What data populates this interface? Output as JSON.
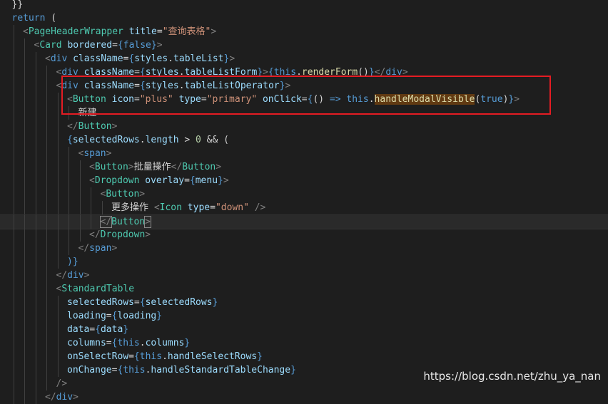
{
  "colors": {
    "background": "#1e1e1e",
    "tag_bracket": "#808080",
    "tag": "#4ec9b0",
    "attr": "#9cdcfe",
    "string": "#ce9178",
    "keyword": "#569cd6",
    "plain": "#d4d4d4",
    "function": "#dcdcaa",
    "number": "#b5cea8",
    "highlight_box": "#e51c23"
  },
  "lines": [
    {
      "indent": 1,
      "tokens": [
        {
          "t": "}}",
          "c": "plain"
        }
      ]
    },
    {
      "indent": 1,
      "tokens": [
        {
          "t": "return",
          "c": "keyword"
        },
        {
          "t": " (",
          "c": "plain"
        }
      ]
    },
    {
      "indent": 2,
      "tokens": [
        {
          "t": "<",
          "c": "tag_bracket"
        },
        {
          "t": "PageHeaderWrapper",
          "c": "tag"
        },
        {
          "t": " ",
          "c": "plain"
        },
        {
          "t": "title",
          "c": "attr"
        },
        {
          "t": "=",
          "c": "plain"
        },
        {
          "t": "\"查询表格\"",
          "c": "string"
        },
        {
          "t": ">",
          "c": "tag_bracket"
        }
      ]
    },
    {
      "indent": 3,
      "tokens": [
        {
          "t": "<",
          "c": "tag_bracket"
        },
        {
          "t": "Card",
          "c": "tag"
        },
        {
          "t": " ",
          "c": "plain"
        },
        {
          "t": "bordered",
          "c": "attr"
        },
        {
          "t": "=",
          "c": "plain"
        },
        {
          "t": "{",
          "c": "keyword"
        },
        {
          "t": "false",
          "c": "keyword"
        },
        {
          "t": "}",
          "c": "keyword"
        },
        {
          "t": ">",
          "c": "tag_bracket"
        }
      ]
    },
    {
      "indent": 4,
      "tokens": [
        {
          "t": "<",
          "c": "tag_bracket"
        },
        {
          "t": "div",
          "c": "keyword"
        },
        {
          "t": " ",
          "c": "plain"
        },
        {
          "t": "className",
          "c": "attr"
        },
        {
          "t": "=",
          "c": "plain"
        },
        {
          "t": "{",
          "c": "keyword"
        },
        {
          "t": "styles",
          "c": "attr"
        },
        {
          "t": ".",
          "c": "plain"
        },
        {
          "t": "tableList",
          "c": "attr"
        },
        {
          "t": "}",
          "c": "keyword"
        },
        {
          "t": ">",
          "c": "tag_bracket"
        }
      ]
    },
    {
      "indent": 5,
      "tokens": [
        {
          "t": "<",
          "c": "tag_bracket"
        },
        {
          "t": "div",
          "c": "keyword"
        },
        {
          "t": " ",
          "c": "plain"
        },
        {
          "t": "className",
          "c": "attr"
        },
        {
          "t": "=",
          "c": "plain"
        },
        {
          "t": "{",
          "c": "keyword"
        },
        {
          "t": "styles",
          "c": "attr"
        },
        {
          "t": ".",
          "c": "plain"
        },
        {
          "t": "tableListForm",
          "c": "attr"
        },
        {
          "t": "}",
          "c": "keyword"
        },
        {
          "t": ">",
          "c": "tag_bracket"
        },
        {
          "t": "{",
          "c": "keyword"
        },
        {
          "t": "this",
          "c": "keyword"
        },
        {
          "t": ".",
          "c": "plain"
        },
        {
          "t": "renderForm",
          "c": "function"
        },
        {
          "t": "()",
          "c": "plain"
        },
        {
          "t": "}",
          "c": "keyword"
        },
        {
          "t": "</",
          "c": "tag_bracket"
        },
        {
          "t": "div",
          "c": "keyword"
        },
        {
          "t": ">",
          "c": "tag_bracket"
        }
      ]
    },
    {
      "indent": 5,
      "tokens": [
        {
          "t": "<",
          "c": "tag_bracket"
        },
        {
          "t": "div",
          "c": "keyword"
        },
        {
          "t": " ",
          "c": "plain"
        },
        {
          "t": "className",
          "c": "attr"
        },
        {
          "t": "=",
          "c": "plain"
        },
        {
          "t": "{",
          "c": "keyword"
        },
        {
          "t": "styles",
          "c": "attr"
        },
        {
          "t": ".",
          "c": "plain"
        },
        {
          "t": "tableListOperator",
          "c": "attr"
        },
        {
          "t": "}",
          "c": "keyword"
        },
        {
          "t": ">",
          "c": "tag_bracket"
        }
      ]
    },
    {
      "indent": 6,
      "tokens": [
        {
          "t": "<",
          "c": "tag_bracket"
        },
        {
          "t": "Button",
          "c": "tag"
        },
        {
          "t": " ",
          "c": "plain"
        },
        {
          "t": "icon",
          "c": "attr"
        },
        {
          "t": "=",
          "c": "plain"
        },
        {
          "t": "\"plus\"",
          "c": "string"
        },
        {
          "t": " ",
          "c": "plain"
        },
        {
          "t": "type",
          "c": "attr"
        },
        {
          "t": "=",
          "c": "plain"
        },
        {
          "t": "\"primary\"",
          "c": "string"
        },
        {
          "t": " ",
          "c": "plain"
        },
        {
          "t": "onClick",
          "c": "attr"
        },
        {
          "t": "=",
          "c": "plain"
        },
        {
          "t": "{",
          "c": "keyword"
        },
        {
          "t": "()",
          "c": "plain"
        },
        {
          "t": " => ",
          "c": "keyword"
        },
        {
          "t": "this",
          "c": "keyword"
        },
        {
          "t": ".",
          "c": "plain"
        },
        {
          "t": "handleModalVisible",
          "c": "function",
          "hl": true
        },
        {
          "t": "(",
          "c": "plain"
        },
        {
          "t": "true",
          "c": "keyword"
        },
        {
          "t": ")",
          "c": "plain"
        },
        {
          "t": "}",
          "c": "keyword"
        },
        {
          "t": ">",
          "c": "tag_bracket"
        }
      ]
    },
    {
      "indent": 7,
      "tokens": [
        {
          "t": "新建",
          "c": "plain"
        }
      ]
    },
    {
      "indent": 6,
      "tokens": [
        {
          "t": "</",
          "c": "tag_bracket"
        },
        {
          "t": "Button",
          "c": "tag"
        },
        {
          "t": ">",
          "c": "tag_bracket"
        }
      ]
    },
    {
      "indent": 6,
      "tokens": [
        {
          "t": "{",
          "c": "keyword"
        },
        {
          "t": "selectedRows",
          "c": "attr"
        },
        {
          "t": ".",
          "c": "plain"
        },
        {
          "t": "length",
          "c": "attr"
        },
        {
          "t": " > ",
          "c": "plain"
        },
        {
          "t": "0",
          "c": "number"
        },
        {
          "t": " && (",
          "c": "plain"
        }
      ]
    },
    {
      "indent": 7,
      "tokens": [
        {
          "t": "<",
          "c": "tag_bracket"
        },
        {
          "t": "span",
          "c": "keyword"
        },
        {
          "t": ">",
          "c": "tag_bracket"
        }
      ]
    },
    {
      "indent": 8,
      "tokens": [
        {
          "t": "<",
          "c": "tag_bracket"
        },
        {
          "t": "Button",
          "c": "tag"
        },
        {
          "t": ">",
          "c": "tag_bracket"
        },
        {
          "t": "批量操作",
          "c": "plain"
        },
        {
          "t": "</",
          "c": "tag_bracket"
        },
        {
          "t": "Button",
          "c": "tag"
        },
        {
          "t": ">",
          "c": "tag_bracket"
        }
      ]
    },
    {
      "indent": 8,
      "tokens": [
        {
          "t": "<",
          "c": "tag_bracket"
        },
        {
          "t": "Dropdown",
          "c": "tag"
        },
        {
          "t": " ",
          "c": "plain"
        },
        {
          "t": "overlay",
          "c": "attr"
        },
        {
          "t": "=",
          "c": "plain"
        },
        {
          "t": "{",
          "c": "keyword"
        },
        {
          "t": "menu",
          "c": "attr"
        },
        {
          "t": "}",
          "c": "keyword"
        },
        {
          "t": ">",
          "c": "tag_bracket"
        }
      ]
    },
    {
      "indent": 9,
      "tokens": [
        {
          "t": "<",
          "c": "tag_bracket"
        },
        {
          "t": "Button",
          "c": "tag"
        },
        {
          "t": ">",
          "c": "tag_bracket"
        }
      ]
    },
    {
      "indent": 10,
      "tokens": [
        {
          "t": "更多操作 ",
          "c": "plain"
        },
        {
          "t": "<",
          "c": "tag_bracket"
        },
        {
          "t": "Icon",
          "c": "tag"
        },
        {
          "t": " ",
          "c": "plain"
        },
        {
          "t": "type",
          "c": "attr"
        },
        {
          "t": "=",
          "c": "plain"
        },
        {
          "t": "\"down\"",
          "c": "string"
        },
        {
          "t": " />",
          "c": "tag_bracket"
        }
      ]
    },
    {
      "indent": 9,
      "current": true,
      "tokens": [
        {
          "t": "</",
          "c": "tag_bracket",
          "cur": true
        },
        {
          "t": "Button",
          "c": "tag"
        },
        {
          "t": ">",
          "c": "tag_bracket",
          "cur": true
        }
      ]
    },
    {
      "indent": 8,
      "tokens": [
        {
          "t": "</",
          "c": "tag_bracket"
        },
        {
          "t": "Dropdown",
          "c": "tag"
        },
        {
          "t": ">",
          "c": "tag_bracket"
        }
      ]
    },
    {
      "indent": 7,
      "tokens": [
        {
          "t": "</",
          "c": "tag_bracket"
        },
        {
          "t": "span",
          "c": "keyword"
        },
        {
          "t": ">",
          "c": "tag_bracket"
        }
      ]
    },
    {
      "indent": 6,
      "tokens": [
        {
          "t": ")}",
          "c": "keyword"
        }
      ]
    },
    {
      "indent": 5,
      "tokens": [
        {
          "t": "</",
          "c": "tag_bracket"
        },
        {
          "t": "div",
          "c": "keyword"
        },
        {
          "t": ">",
          "c": "tag_bracket"
        }
      ]
    },
    {
      "indent": 5,
      "tokens": [
        {
          "t": "<",
          "c": "tag_bracket"
        },
        {
          "t": "StandardTable",
          "c": "tag"
        }
      ]
    },
    {
      "indent": 6,
      "tokens": [
        {
          "t": "selectedRows",
          "c": "attr"
        },
        {
          "t": "=",
          "c": "plain"
        },
        {
          "t": "{",
          "c": "keyword"
        },
        {
          "t": "selectedRows",
          "c": "attr"
        },
        {
          "t": "}",
          "c": "keyword"
        }
      ]
    },
    {
      "indent": 6,
      "tokens": [
        {
          "t": "loading",
          "c": "attr"
        },
        {
          "t": "=",
          "c": "plain"
        },
        {
          "t": "{",
          "c": "keyword"
        },
        {
          "t": "loading",
          "c": "attr"
        },
        {
          "t": "}",
          "c": "keyword"
        }
      ]
    },
    {
      "indent": 6,
      "tokens": [
        {
          "t": "data",
          "c": "attr"
        },
        {
          "t": "=",
          "c": "plain"
        },
        {
          "t": "{",
          "c": "keyword"
        },
        {
          "t": "data",
          "c": "attr"
        },
        {
          "t": "}",
          "c": "keyword"
        }
      ]
    },
    {
      "indent": 6,
      "tokens": [
        {
          "t": "columns",
          "c": "attr"
        },
        {
          "t": "=",
          "c": "plain"
        },
        {
          "t": "{",
          "c": "keyword"
        },
        {
          "t": "this",
          "c": "keyword"
        },
        {
          "t": ".",
          "c": "plain"
        },
        {
          "t": "columns",
          "c": "attr"
        },
        {
          "t": "}",
          "c": "keyword"
        }
      ]
    },
    {
      "indent": 6,
      "tokens": [
        {
          "t": "onSelectRow",
          "c": "attr"
        },
        {
          "t": "=",
          "c": "plain"
        },
        {
          "t": "{",
          "c": "keyword"
        },
        {
          "t": "this",
          "c": "keyword"
        },
        {
          "t": ".",
          "c": "plain"
        },
        {
          "t": "handleSelectRows",
          "c": "attr"
        },
        {
          "t": "}",
          "c": "keyword"
        }
      ]
    },
    {
      "indent": 6,
      "tokens": [
        {
          "t": "onChange",
          "c": "attr"
        },
        {
          "t": "=",
          "c": "plain"
        },
        {
          "t": "{",
          "c": "keyword"
        },
        {
          "t": "this",
          "c": "keyword"
        },
        {
          "t": ".",
          "c": "plain"
        },
        {
          "t": "handleStandardTableChange",
          "c": "attr"
        },
        {
          "t": "}",
          "c": "keyword"
        }
      ]
    },
    {
      "indent": 5,
      "tokens": [
        {
          "t": "/>",
          "c": "tag_bracket"
        }
      ]
    },
    {
      "indent": 4,
      "tokens": [
        {
          "t": "</",
          "c": "tag_bracket"
        },
        {
          "t": "div",
          "c": "keyword"
        },
        {
          "t": ">",
          "c": "tag_bracket"
        }
      ]
    }
  ],
  "watermark": "https://blog.csdn.net/zhu_ya_nan"
}
